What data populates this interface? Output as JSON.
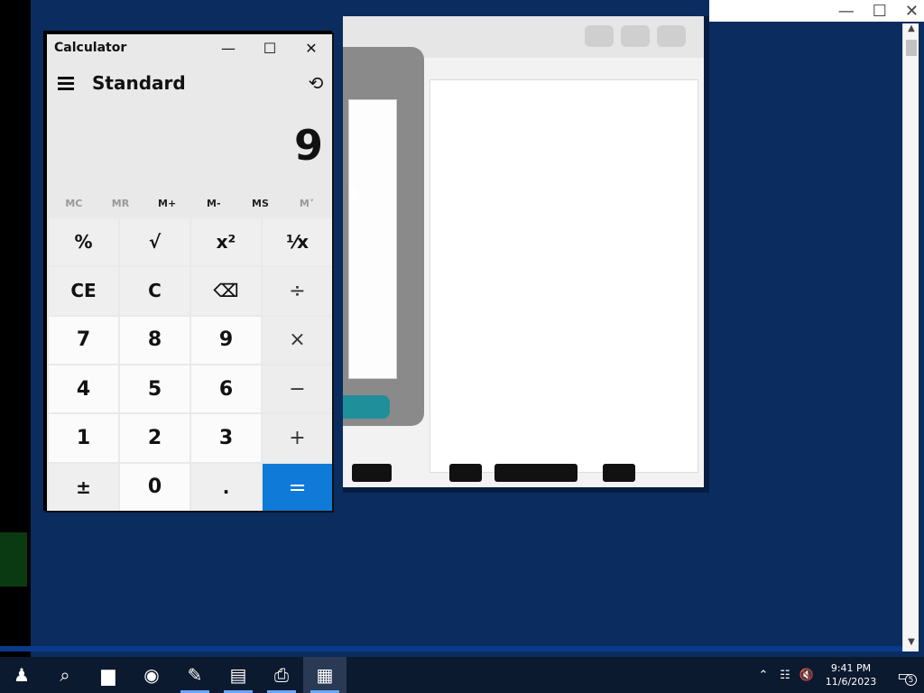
{
  "calculator": {
    "app_title": "Calculator",
    "mode": "Standard",
    "expression": "",
    "display": "9",
    "window_buttons": {
      "minimize": "—",
      "maximize": "☐",
      "close": "✕"
    },
    "memory": [
      "MC",
      "MR",
      "M+",
      "M-",
      "MS",
      "M˅"
    ],
    "keys": [
      {
        "label": "%",
        "kind": "func",
        "name": "percent-key"
      },
      {
        "label": "√",
        "kind": "func",
        "name": "square-root-key"
      },
      {
        "label": "x²",
        "kind": "func",
        "name": "square-key"
      },
      {
        "label": "¹⁄x",
        "kind": "func",
        "name": "reciprocal-key"
      },
      {
        "label": "CE",
        "kind": "func",
        "name": "clear-entry-key"
      },
      {
        "label": "C",
        "kind": "func",
        "name": "clear-key"
      },
      {
        "label": "⌫",
        "kind": "func",
        "name": "backspace-key"
      },
      {
        "label": "÷",
        "kind": "op",
        "name": "divide-key"
      },
      {
        "label": "7",
        "kind": "digit",
        "name": "digit-7-key"
      },
      {
        "label": "8",
        "kind": "digit",
        "name": "digit-8-key"
      },
      {
        "label": "9",
        "kind": "digit",
        "name": "digit-9-key"
      },
      {
        "label": "×",
        "kind": "op",
        "name": "multiply-key"
      },
      {
        "label": "4",
        "kind": "digit",
        "name": "digit-4-key"
      },
      {
        "label": "5",
        "kind": "digit",
        "name": "digit-5-key"
      },
      {
        "label": "6",
        "kind": "digit",
        "name": "digit-6-key"
      },
      {
        "label": "−",
        "kind": "op",
        "name": "subtract-key"
      },
      {
        "label": "1",
        "kind": "digit",
        "name": "digit-1-key"
      },
      {
        "label": "2",
        "kind": "digit",
        "name": "digit-2-key"
      },
      {
        "label": "3",
        "kind": "digit",
        "name": "digit-3-key"
      },
      {
        "label": "+",
        "kind": "op",
        "name": "add-key"
      },
      {
        "label": "±",
        "kind": "func",
        "name": "negate-key"
      },
      {
        "label": "0",
        "kind": "digit",
        "name": "digit-0-key"
      },
      {
        "label": ".",
        "kind": "func",
        "name": "decimal-key"
      },
      {
        "label": "=",
        "kind": "equals",
        "name": "equals-key"
      }
    ]
  },
  "edge_window": {
    "minimize": "—",
    "maximize": "☐",
    "close": "✕"
  },
  "scrollbar": {
    "up": "▲",
    "down": "▼"
  },
  "taskbar": {
    "items": [
      {
        "icon": "person-icon",
        "glyph": "♟"
      },
      {
        "icon": "search-icon",
        "glyph": "⌕"
      },
      {
        "icon": "folder-icon",
        "glyph": "▆"
      },
      {
        "icon": "chrome-icon",
        "glyph": "◉"
      },
      {
        "icon": "editor-icon",
        "glyph": "✎"
      },
      {
        "icon": "document-icon",
        "glyph": "▤"
      },
      {
        "icon": "printer-icon",
        "glyph": "⎙"
      },
      {
        "icon": "calculator-icon",
        "glyph": "▦"
      }
    ],
    "tray": {
      "chevron": "⌃",
      "network": "☷",
      "volume": "🔇"
    },
    "time": "9:41 PM",
    "date": "11/6/2023",
    "notification_count": "5",
    "notification_glyph": "▭"
  },
  "colors": {
    "accent": "#0f7ad8",
    "desktop": "#0b2c5e",
    "taskbar": "#0c1a30"
  }
}
